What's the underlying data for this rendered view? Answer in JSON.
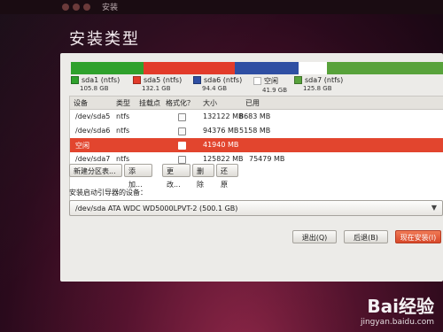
{
  "window": {
    "title": "安装"
  },
  "page_title": "安装类型",
  "partitions_bar": [
    {
      "name": "sda1 (ntfs)",
      "size": "105.8 GB",
      "color": "#2fa12c"
    },
    {
      "name": "sda5 (ntfs)",
      "size": "132.1 GB",
      "color": "#e23b2a"
    },
    {
      "name": "sda6 (ntfs)",
      "size": "94.4 GB",
      "color": "#2f4fa3"
    },
    {
      "name": "空闲",
      "size": "41.9 GB",
      "color": "#ffffff"
    },
    {
      "name": "sda7 (ntfs)",
      "size": "125.8 GB",
      "color": "#58a23b"
    }
  ],
  "table": {
    "headers": [
      "设备",
      "类型",
      "挂载点",
      "格式化？",
      "大小",
      "已用"
    ],
    "rows": [
      {
        "device": "/dev/sda5",
        "type": "ntfs",
        "mount": "",
        "format": false,
        "size": "132122 MB",
        "used": "8683 MB",
        "selected": false
      },
      {
        "device": "/dev/sda6",
        "type": "ntfs",
        "mount": "",
        "format": false,
        "size": "94376 MB",
        "used": "5158 MB",
        "selected": false
      },
      {
        "device": "空闲",
        "type": "",
        "mount": "",
        "format": false,
        "size": "41940 MB",
        "used": "",
        "selected": true
      },
      {
        "device": "/dev/sda7",
        "type": "ntfs",
        "mount": "",
        "format": false,
        "size": "125822 MB",
        "used": "75479 MB",
        "selected": false
      }
    ]
  },
  "actions": {
    "new_table": "新建分区表...",
    "add": "添加...",
    "change": "更改...",
    "delete": "删除",
    "revert": "还原"
  },
  "boot_loader": {
    "label": "安装启动引导器的设备：",
    "value": "/dev/sda    ATA WDC WD5000LPVT-2 (500.1 GB)"
  },
  "footer": {
    "quit": "退出(Q)",
    "back": "后退(B)",
    "install": "现在安装(I)"
  },
  "watermark": {
    "main": "Bai经验",
    "sub": "jingyan.baidu.com"
  }
}
